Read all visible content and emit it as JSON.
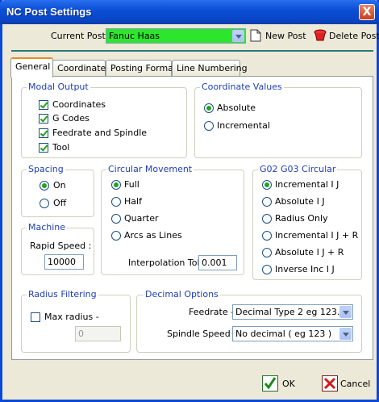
{
  "window": {
    "title": "NC Post Settings",
    "close_glyph": "X"
  },
  "header": {
    "current_post_label": "Current Post -",
    "current_post_value": "Fanuc Haas",
    "current_post_color": "#2ee52e",
    "new_post_label": "New Post",
    "delete_post_label": "Delete Post"
  },
  "tabs": [
    "General",
    "Coordinates",
    "Posting Format",
    "Line Numbering"
  ],
  "modal_output": {
    "title": "Modal Output",
    "items": [
      {
        "label": "Coordinates",
        "checked": true
      },
      {
        "label": "G Codes",
        "checked": true
      },
      {
        "label": "Feedrate and Spindle",
        "checked": true
      },
      {
        "label": "Tool",
        "checked": true
      }
    ]
  },
  "coordinate_values": {
    "title": "Coordinate Values",
    "options": [
      {
        "label": "Absolute",
        "selected": true
      },
      {
        "label": "Incremental",
        "selected": false
      }
    ]
  },
  "spacing": {
    "title": "Spacing",
    "options": [
      {
        "label": "On",
        "selected": true
      },
      {
        "label": "Off",
        "selected": false
      }
    ]
  },
  "circular_movement": {
    "title": "Circular Movement",
    "options": [
      {
        "label": "Full",
        "selected": true
      },
      {
        "label": "Half",
        "selected": false
      },
      {
        "label": "Quarter",
        "selected": false
      },
      {
        "label": "Arcs as Lines",
        "selected": false
      }
    ],
    "interp_label": "Interpolation Tol :",
    "interp_value": "0.001"
  },
  "g02g03": {
    "title": "G02 G03 Circular",
    "options": [
      {
        "label": "Incremental I J",
        "selected": true
      },
      {
        "label": "Absolute I J",
        "selected": false
      },
      {
        "label": "Radius Only",
        "selected": false
      },
      {
        "label": "Incremental I J + R",
        "selected": false
      },
      {
        "label": "Absolute I J + R",
        "selected": false
      },
      {
        "label": "Inverse Inc I J",
        "selected": false
      }
    ]
  },
  "machine": {
    "title": "Machine",
    "rapid_label": "Rapid Speed :",
    "rapid_value": "10000"
  },
  "radius_filtering": {
    "title": "Radius Filtering",
    "max_radius_label": "Max radius -",
    "max_radius_checked": false,
    "max_radius_value": "0"
  },
  "decimal_options": {
    "title": "Decimal Options",
    "feedrate_label": "Feedrate -",
    "feedrate_value": "Decimal Type 2 eg 123.",
    "spindle_label": "Spindle Speed -",
    "spindle_value": "No decimal ( eg 123 )"
  },
  "footer": {
    "ok_label": "OK",
    "cancel_label": "Cancel"
  }
}
